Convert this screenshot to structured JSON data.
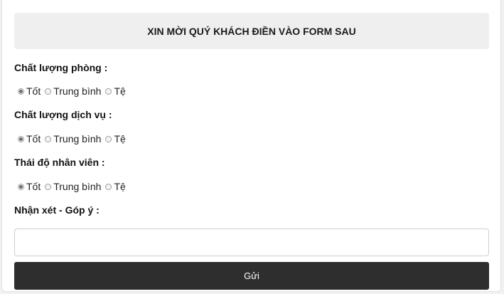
{
  "form": {
    "title": "XIN MỜI QUÝ KHÁCH ĐIỀN VÀO FORM SAU",
    "questions": [
      {
        "label": "Chất lượng phòng :",
        "options": [
          "Tốt",
          "Trung bình",
          "Tệ"
        ],
        "selected": "Tốt"
      },
      {
        "label": "Chất lượng dịch vụ :",
        "options": [
          "Tốt",
          "Trung bình",
          "Tệ"
        ],
        "selected": "Tốt"
      },
      {
        "label": "Thái độ nhân viên :",
        "options": [
          "Tốt",
          "Trung bình",
          "Tệ"
        ],
        "selected": "Tốt"
      }
    ],
    "comment_label": "Nhận xét - Góp ý :",
    "comment_value": "",
    "submit_label": "Gửi"
  }
}
